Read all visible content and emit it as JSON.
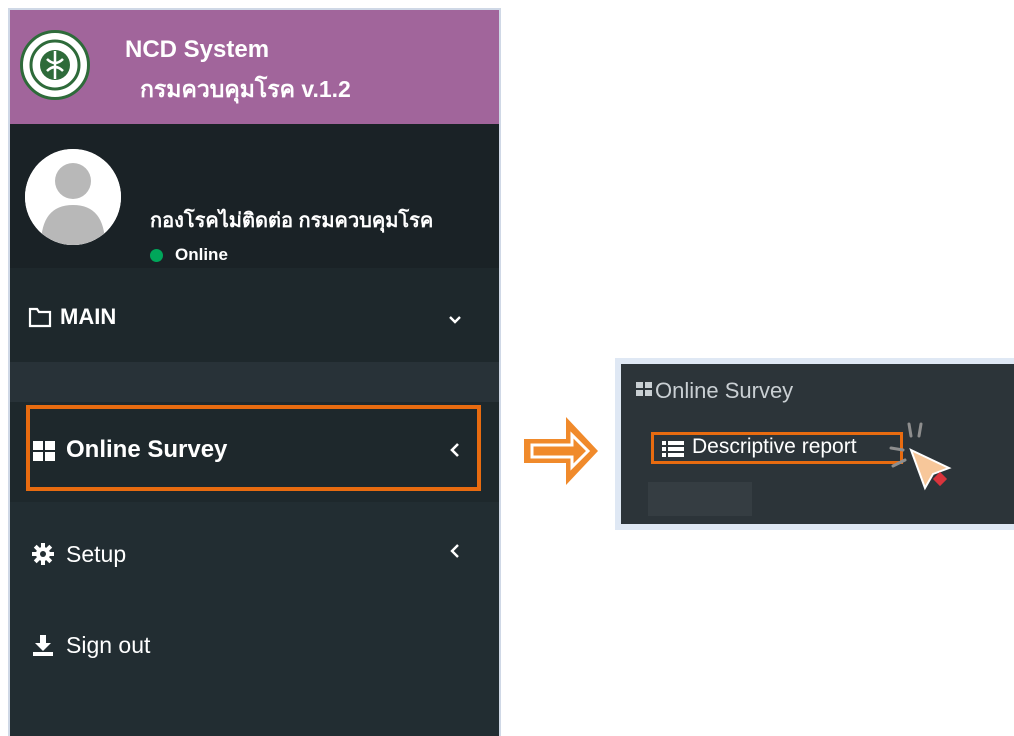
{
  "brand": {
    "title": "NCD System",
    "subtitle": "กรมควบคุมโรค  v.1.2",
    "logo_icon": "department-seal-icon"
  },
  "user": {
    "name": "กองโรคไม่ติดต่อ กรมควบคุมโรค",
    "status": "Online",
    "status_color": "#00a65a"
  },
  "menu": {
    "main": {
      "label": "MAIN",
      "icon": "folder-icon",
      "chevron": "chevron-down-icon"
    },
    "online_survey": {
      "label": "Online Survey",
      "icon": "grid-icon",
      "chevron": "chevron-left-icon"
    },
    "setup": {
      "label": "Setup",
      "icon": "gear-icon",
      "chevron": "chevron-left-icon"
    },
    "sign_out": {
      "label": "Sign out",
      "icon": "download-icon"
    }
  },
  "popup": {
    "parent_label": "Online Survey",
    "child_label": "Descriptive report",
    "child_icon": "list-icon"
  },
  "colors": {
    "brand": "#a1659b",
    "sidebar": "#222d32",
    "highlight": "#e86b10"
  }
}
